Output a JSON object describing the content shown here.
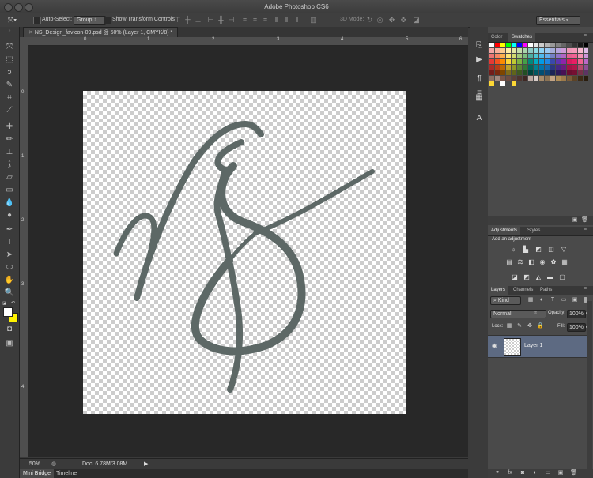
{
  "app": {
    "title": "Adobe Photoshop CS6"
  },
  "options_bar": {
    "auto_select_label": "Auto-Select:",
    "auto_select_value": "Group",
    "show_transform_label": "Show Transform Controls",
    "mode_3d_label": "3D Mode:",
    "workspace": "Essentials"
  },
  "document": {
    "tab_title": "NS_Design_favicon-09.psd @ 50% (Layer 1, CMYK/8) *",
    "ruler_h": [
      "0",
      "1",
      "2",
      "3",
      "4",
      "5",
      "6"
    ],
    "ruler_v": [
      "0",
      "1",
      "2",
      "3",
      "4"
    ],
    "canvas_bg_colors": {
      "light": "#ffffff",
      "dark": "#cccccc"
    },
    "stroke_color": "#5d6866"
  },
  "status": {
    "zoom": "50%",
    "doc_info": "Doc: 6.78M/3.08M"
  },
  "bottom_tabs": [
    "Mini Bridge",
    "Timeline"
  ],
  "color_panel": {
    "tabs": [
      "Color",
      "Swatches"
    ],
    "active_tab": "Swatches",
    "row1": [
      "#ffffff",
      "#ff0000",
      "#ffff00",
      "#00ff00",
      "#00ffff",
      "#0000ff",
      "#ff00ff",
      "#ffffff",
      "#e6e6e6",
      "#cccccc",
      "#b3b3b3",
      "#999999",
      "#808080",
      "#666666",
      "#4d4d4d",
      "#333333",
      "#1a1a1a",
      "#000000"
    ],
    "rows_hues": [
      "#e53935",
      "#f4511e",
      "#fb8c00",
      "#fdd835",
      "#c0ca33",
      "#7cb342",
      "#43a047",
      "#00897b",
      "#00acc1",
      "#039be5",
      "#1e88e5",
      "#3949ab",
      "#5e35b1",
      "#8e24aa",
      "#d81b60",
      "#e91e63",
      "#f06292",
      "#ba68c8"
    ],
    "bottom_row": [
      "#8d6e63",
      "#a1887f",
      "#795548",
      "#6d4c41",
      "#5d4037",
      "#4e342e",
      "#3e2723",
      "#bcaaa4",
      "#d7ccc8",
      "#a68b6b",
      "#8b7355",
      "#c4a484",
      "#b08d57",
      "#9c7a4a",
      "#7a5c3a",
      "#5c4326",
      "#3d2b16",
      "#2a1d0e"
    ],
    "extra_row": [
      "#fdd835",
      "#ffffff",
      "#fdd835"
    ]
  },
  "adjustments": {
    "tabs": [
      "Adjustments",
      "Styles"
    ],
    "active_tab": "Adjustments",
    "hint": "Add an adjustment",
    "row1_icons": [
      "brightness-icon",
      "levels-icon",
      "curves-icon",
      "exposure-icon",
      "vibrance-icon"
    ],
    "row2_icons": [
      "hue-saturation-icon",
      "color-balance-icon",
      "black-white-icon",
      "photo-filter-icon",
      "channel-mixer-icon",
      "color-lookup-icon"
    ],
    "row3_icons": [
      "invert-icon",
      "posterize-icon",
      "threshold-icon",
      "gradient-map-icon",
      "selective-color-icon"
    ]
  },
  "layers": {
    "tabs": [
      "Layers",
      "Channels",
      "Paths"
    ],
    "active_tab": "Layers",
    "kind_label": "Kind",
    "blend_mode": "Normal",
    "opacity_label": "Opacity:",
    "opacity_value": "100%",
    "lock_label": "Lock:",
    "fill_label": "Fill:",
    "fill_value": "100%",
    "items": [
      {
        "name": "Layer 1",
        "visible": true,
        "selected": true
      }
    ]
  }
}
